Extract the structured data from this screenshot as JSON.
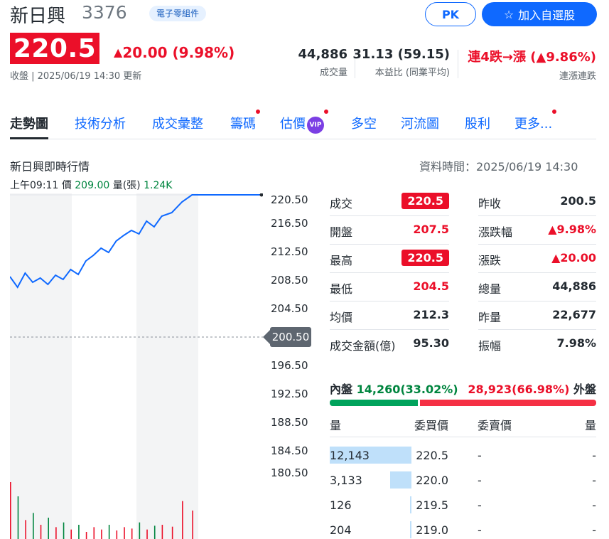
{
  "header": {
    "name": "新日興",
    "code": "3376",
    "sector": "電子零組件",
    "pk_label": "PK",
    "watchlist_label": "加入自選股"
  },
  "price": {
    "value": "220.5",
    "change": "20.00 (9.98%)",
    "meta": "收盤 | 2025/06/19 14:30 更新"
  },
  "stats": [
    {
      "value": "44,886",
      "label": "成交量"
    },
    {
      "value": "31.13 (59.15)",
      "label": "本益比 (同業平均)"
    },
    {
      "value": "連4跌→漲 (▲9.86%)",
      "label": "連漲連跌"
    }
  ],
  "tabs": [
    {
      "label": "走勢圖",
      "active": true,
      "dot": false
    },
    {
      "label": "技術分析",
      "dot": false
    },
    {
      "label": "成交彙整",
      "dot": false
    },
    {
      "label": "籌碼",
      "dot": true
    },
    {
      "label": "估價",
      "dot": true,
      "vip": "VIP"
    },
    {
      "label": "多空",
      "dot": false
    },
    {
      "label": "河流圖",
      "dot": false
    },
    {
      "label": "股利",
      "dot": false
    },
    {
      "label": "更多...",
      "dot": true
    }
  ],
  "realtime": {
    "title": "新日興即時行情",
    "data_time": "資料時間：2025/06/19 14:30",
    "cursor_time": "上午09:11",
    "cursor_price_label": "價",
    "cursor_price": "209.00",
    "cursor_vol_label": "量(張)",
    "cursor_vol": "1.24K"
  },
  "chart_data": {
    "type": "line",
    "y_ticks": [
      "220.50",
      "216.50",
      "212.50",
      "208.50",
      "204.50",
      "200.50",
      "196.50",
      "192.50",
      "188.50",
      "184.50",
      "180.50"
    ],
    "reference_price": "200.50",
    "ylim": [
      180.5,
      220.5
    ],
    "x_session_fraction": [
      0,
      0.03,
      0.06,
      0.09,
      0.12,
      0.15,
      0.18,
      0.21,
      0.24,
      0.27,
      0.3,
      0.33,
      0.36,
      0.39,
      0.42,
      0.45,
      0.48,
      0.51,
      0.54,
      0.57,
      0.6,
      0.64,
      0.68,
      0.72,
      1.0
    ],
    "price": [
      209.0,
      207.5,
      209.5,
      208.2,
      208.8,
      207.9,
      209.2,
      208.6,
      210.0,
      209.3,
      211.2,
      212.0,
      213.0,
      212.4,
      214.0,
      214.8,
      215.5,
      215.0,
      216.8,
      216.0,
      217.5,
      218.0,
      219.5,
      220.5,
      220.5
    ],
    "volume": [
      120,
      90,
      40,
      55,
      30,
      45,
      25,
      35,
      20,
      30,
      15,
      25,
      20,
      30,
      18,
      25,
      22,
      35,
      20,
      28,
      30,
      26,
      80,
      60,
      40
    ]
  },
  "quote": {
    "left": [
      {
        "label": "成交",
        "value": "220.5",
        "style": "badge"
      },
      {
        "label": "開盤",
        "value": "207.5",
        "style": "red"
      },
      {
        "label": "最高",
        "value": "220.5",
        "style": "badge"
      },
      {
        "label": "最低",
        "value": "204.5",
        "style": "red"
      },
      {
        "label": "均價",
        "value": "212.3",
        "style": "plain"
      },
      {
        "label": "成交金額(億)",
        "value": "95.30",
        "style": "plain"
      }
    ],
    "right": [
      {
        "label": "昨收",
        "value": "200.5",
        "style": "plain"
      },
      {
        "label": "漲跌幅",
        "value": "▲9.98%",
        "style": "red"
      },
      {
        "label": "漲跌",
        "value": "▲20.00",
        "style": "red"
      },
      {
        "label": "總量",
        "value": "44,886",
        "style": "plain"
      },
      {
        "label": "昨量",
        "value": "22,677",
        "style": "plain"
      },
      {
        "label": "振幅",
        "value": "7.98%",
        "style": "plain"
      }
    ]
  },
  "inout": {
    "in_label": "內盤",
    "in_value": "14,260(33.02%)",
    "out_value": "28,923(66.98%)",
    "out_label": "外盤",
    "in_fraction": 0.3302
  },
  "orderbook": {
    "headers": [
      "量",
      "委買價",
      "委賣價",
      "量"
    ],
    "rows": [
      {
        "bid_vol": "12,143",
        "bid": "220.5",
        "ask": "-",
        "ask_vol": "-",
        "bar_fraction": 1.0
      },
      {
        "bid_vol": "3,133",
        "bid": "220.0",
        "ask": "-",
        "ask_vol": "-",
        "bar_fraction": 0.26
      },
      {
        "bid_vol": "126",
        "bid": "219.5",
        "ask": "-",
        "ask_vol": "-",
        "bar_fraction": 0.01
      },
      {
        "bid_vol": "204",
        "bid": "219.0",
        "ask": "-",
        "ask_vol": "-",
        "bar_fraction": 0.017
      }
    ]
  },
  "colors": {
    "up": "#eb0f29",
    "down": "#00853f",
    "accent": "#0f69ff",
    "line": "#0f69ff"
  }
}
